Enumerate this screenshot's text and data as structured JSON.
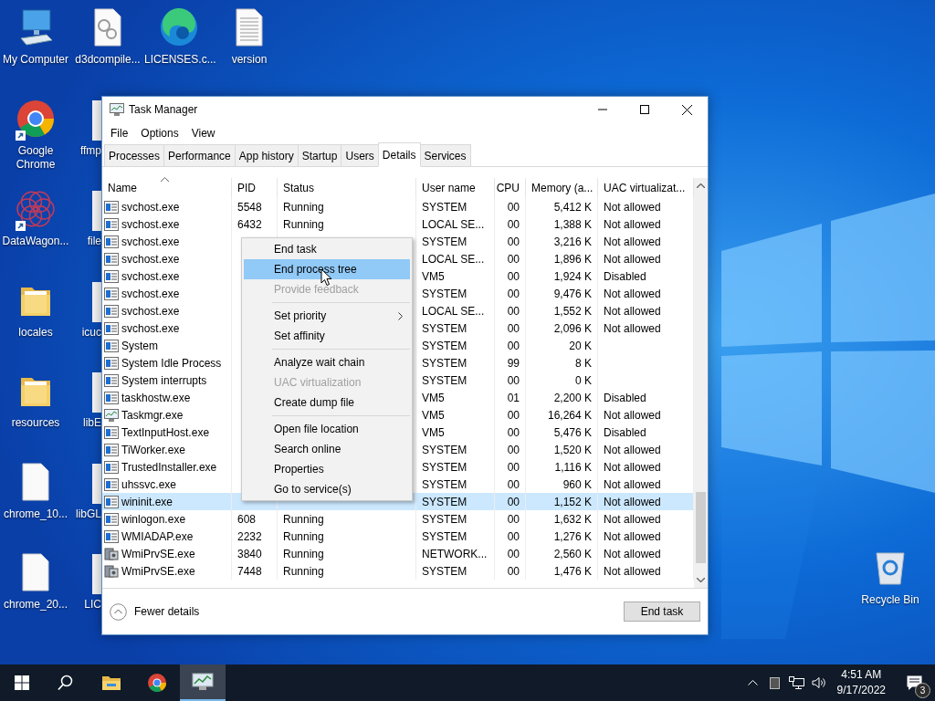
{
  "desktop": {
    "column_1": [
      {
        "label": "My Computer",
        "kind": "computer",
        "shortcut": false
      },
      {
        "label": "Google Chrome",
        "kind": "chrome",
        "shortcut": true
      },
      {
        "label": "DataWagon...",
        "kind": "network-logo",
        "shortcut": true
      },
      {
        "label": "locales",
        "kind": "folder",
        "shortcut": false
      },
      {
        "label": "resources",
        "kind": "folder",
        "shortcut": false
      },
      {
        "label": "chrome_10...",
        "kind": "document",
        "shortcut": false
      },
      {
        "label": "chrome_20...",
        "kind": "document",
        "shortcut": false
      }
    ],
    "top_row": [
      {
        "label": "d3dcompile...",
        "kind": "gear-document"
      },
      {
        "label": "LICENSES.c...",
        "kind": "edge"
      },
      {
        "label": "version",
        "kind": "text-document"
      }
    ],
    "column_2": [
      {
        "label": "ffmp"
      },
      {
        "label": "file"
      },
      {
        "label": "icuc"
      },
      {
        "label": "libE"
      },
      {
        "label": "libGL"
      },
      {
        "label": "LIC"
      }
    ],
    "recycle_bin": {
      "label": "Recycle Bin"
    }
  },
  "window": {
    "title": "Task Manager",
    "menu": [
      "File",
      "Options",
      "View"
    ],
    "tabs": [
      {
        "label": "Processes",
        "selected": false
      },
      {
        "label": "Performance",
        "selected": false
      },
      {
        "label": "App history",
        "selected": false
      },
      {
        "label": "Startup",
        "selected": false
      },
      {
        "label": "Users",
        "selected": false
      },
      {
        "label": "Details",
        "selected": true
      },
      {
        "label": "Services",
        "selected": false
      }
    ],
    "table": {
      "columns": [
        "Name",
        "PID",
        "Status",
        "User name",
        "CPU",
        "Memory (a...",
        "UAC virtualizat..."
      ],
      "rows": [
        {
          "kind": "app",
          "name": "svchost.exe",
          "pid": "5548",
          "status": "Running",
          "user": "SYSTEM",
          "cpu": "00",
          "memory": "5,412 K",
          "uac": "Not allowed",
          "selected": false
        },
        {
          "kind": "app",
          "name": "svchost.exe",
          "pid": "6432",
          "status": "Running",
          "user": "LOCAL SE...",
          "cpu": "00",
          "memory": "1,388 K",
          "uac": "Not allowed",
          "selected": false
        },
        {
          "kind": "app",
          "name": "svchost.exe",
          "user": "SYSTEM",
          "cpu": "00",
          "memory": "3,216 K",
          "uac": "Not allowed",
          "selected": false
        },
        {
          "kind": "app",
          "name": "svchost.exe",
          "user": "LOCAL SE...",
          "cpu": "00",
          "memory": "1,896 K",
          "uac": "Not allowed",
          "selected": false
        },
        {
          "kind": "app",
          "name": "svchost.exe",
          "user": "VM5",
          "cpu": "00",
          "memory": "1,924 K",
          "uac": "Disabled",
          "selected": false
        },
        {
          "kind": "app",
          "name": "svchost.exe",
          "user": "SYSTEM",
          "cpu": "00",
          "memory": "9,476 K",
          "uac": "Not allowed",
          "selected": false
        },
        {
          "kind": "app",
          "name": "svchost.exe",
          "user": "LOCAL SE...",
          "cpu": "00",
          "memory": "1,552 K",
          "uac": "Not allowed",
          "selected": false
        },
        {
          "kind": "app",
          "name": "svchost.exe",
          "user": "SYSTEM",
          "cpu": "00",
          "memory": "2,096 K",
          "uac": "Not allowed",
          "selected": false
        },
        {
          "kind": "app",
          "name": "System",
          "user": "SYSTEM",
          "cpu": "00",
          "memory": "20 K",
          "selected": false
        },
        {
          "kind": "app",
          "name": "System Idle Process",
          "user": "SYSTEM",
          "cpu": "99",
          "memory": "8 K",
          "selected": false
        },
        {
          "kind": "app",
          "name": "System interrupts",
          "user": "SYSTEM",
          "cpu": "00",
          "memory": "0 K",
          "selected": false
        },
        {
          "kind": "app",
          "name": "taskhostw.exe",
          "user": "VM5",
          "cpu": "01",
          "memory": "2,200 K",
          "uac": "Disabled",
          "selected": false
        },
        {
          "kind": "monitor",
          "name": "Taskmgr.exe",
          "user": "VM5",
          "cpu": "00",
          "memory": "16,264 K",
          "uac": "Not allowed",
          "selected": false
        },
        {
          "kind": "app",
          "name": "TextInputHost.exe",
          "user": "VM5",
          "cpu": "00",
          "memory": "5,476 K",
          "uac": "Disabled",
          "selected": false
        },
        {
          "kind": "app",
          "name": "TiWorker.exe",
          "user": "SYSTEM",
          "cpu": "00",
          "memory": "1,520 K",
          "uac": "Not allowed",
          "selected": false
        },
        {
          "kind": "app",
          "name": "TrustedInstaller.exe",
          "user": "SYSTEM",
          "cpu": "00",
          "memory": "1,116 K",
          "uac": "Not allowed",
          "selected": false
        },
        {
          "kind": "app",
          "name": "uhssvc.exe",
          "user": "SYSTEM",
          "cpu": "00",
          "memory": "960 K",
          "uac": "Not allowed",
          "selected": false
        },
        {
          "kind": "app",
          "name": "wininit.exe",
          "user": "SYSTEM",
          "cpu": "00",
          "memory": "1,152 K",
          "uac": "Not allowed",
          "selected": true
        },
        {
          "kind": "app",
          "name": "winlogon.exe",
          "pid": "608",
          "status": "Running",
          "user": "SYSTEM",
          "cpu": "00",
          "memory": "1,632 K",
          "uac": "Not allowed",
          "selected": false
        },
        {
          "kind": "app",
          "name": "WMIADAP.exe",
          "pid": "2232",
          "status": "Running",
          "user": "SYSTEM",
          "cpu": "00",
          "memory": "1,276 K",
          "uac": "Not allowed",
          "selected": false
        },
        {
          "kind": "service",
          "name": "WmiPrvSE.exe",
          "pid": "3840",
          "status": "Running",
          "user": "NETWORK...",
          "cpu": "00",
          "memory": "2,560 K",
          "uac": "Not allowed",
          "selected": false
        },
        {
          "kind": "service",
          "name": "WmiPrvSE.exe",
          "pid": "7448",
          "status": "Running",
          "user": "SYSTEM",
          "cpu": "00",
          "memory": "1,476 K",
          "uac": "Not allowed",
          "selected": false
        }
      ]
    },
    "context_menu": [
      {
        "kind": "item",
        "label": "End task",
        "highlighted": false,
        "disabled": false,
        "submenu": false
      },
      {
        "kind": "item",
        "label": "End process tree",
        "highlighted": true,
        "disabled": false,
        "submenu": false
      },
      {
        "kind": "item",
        "label": "Provide feedback",
        "highlighted": false,
        "disabled": true,
        "submenu": false
      },
      {
        "kind": "separator"
      },
      {
        "kind": "item",
        "label": "Set priority",
        "highlighted": false,
        "disabled": false,
        "submenu": true
      },
      {
        "kind": "item",
        "label": "Set affinity",
        "highlighted": false,
        "disabled": false,
        "submenu": false
      },
      {
        "kind": "separator"
      },
      {
        "kind": "item",
        "label": "Analyze wait chain",
        "highlighted": false,
        "disabled": false,
        "submenu": false
      },
      {
        "kind": "item",
        "label": "UAC virtualization",
        "highlighted": false,
        "disabled": true,
        "submenu": false
      },
      {
        "kind": "item",
        "label": "Create dump file",
        "highlighted": false,
        "disabled": false,
        "submenu": false
      },
      {
        "kind": "separator"
      },
      {
        "kind": "item",
        "label": "Open file location",
        "highlighted": false,
        "disabled": false,
        "submenu": false
      },
      {
        "kind": "item",
        "label": "Search online",
        "highlighted": false,
        "disabled": false,
        "submenu": false
      },
      {
        "kind": "item",
        "label": "Properties",
        "highlighted": false,
        "disabled": false,
        "submenu": false
      },
      {
        "kind": "item",
        "label": "Go to service(s)",
        "highlighted": false,
        "disabled": false,
        "submenu": false
      }
    ],
    "fewer_details": "Fewer details",
    "end_task": "End task"
  },
  "taskbar": {
    "apps": [
      {
        "kind": "start",
        "active": false
      },
      {
        "kind": "search",
        "active": false
      },
      {
        "kind": "explorer",
        "active": false
      },
      {
        "kind": "chrome",
        "active": false
      },
      {
        "kind": "task-manager",
        "active": true
      }
    ],
    "time": "4:51 AM",
    "date": "9/17/2022",
    "notifications": "3"
  }
}
